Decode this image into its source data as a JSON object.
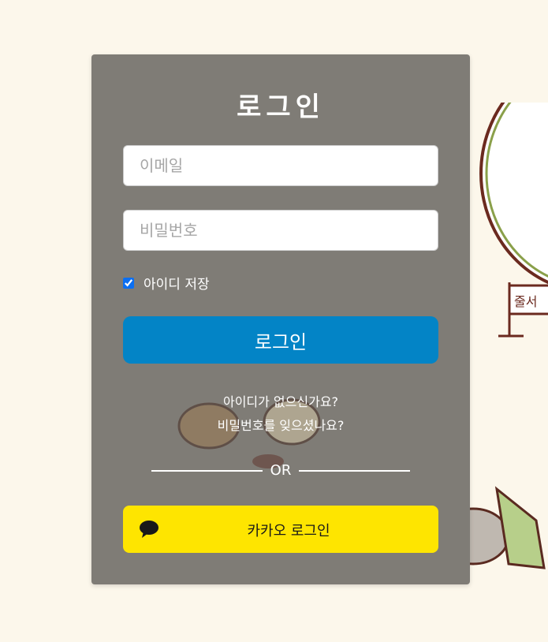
{
  "login": {
    "title": "로그인",
    "email_placeholder": "이메일",
    "password_placeholder": "비밀번호",
    "remember_label": "아이디 저장",
    "remember_checked": true,
    "login_button": "로그인",
    "signup_link": "아이디가 없으신가요?",
    "forgot_link": "비밀번호를 잊으셨나요?",
    "divider": "OR",
    "kakao_button": "카카오 로그인"
  },
  "decoration": {
    "sign_text": "줄서"
  },
  "colors": {
    "background": "#fcf7eb",
    "card": "#7f7c76",
    "primary": "#0384c6",
    "kakao": "#fee500"
  }
}
